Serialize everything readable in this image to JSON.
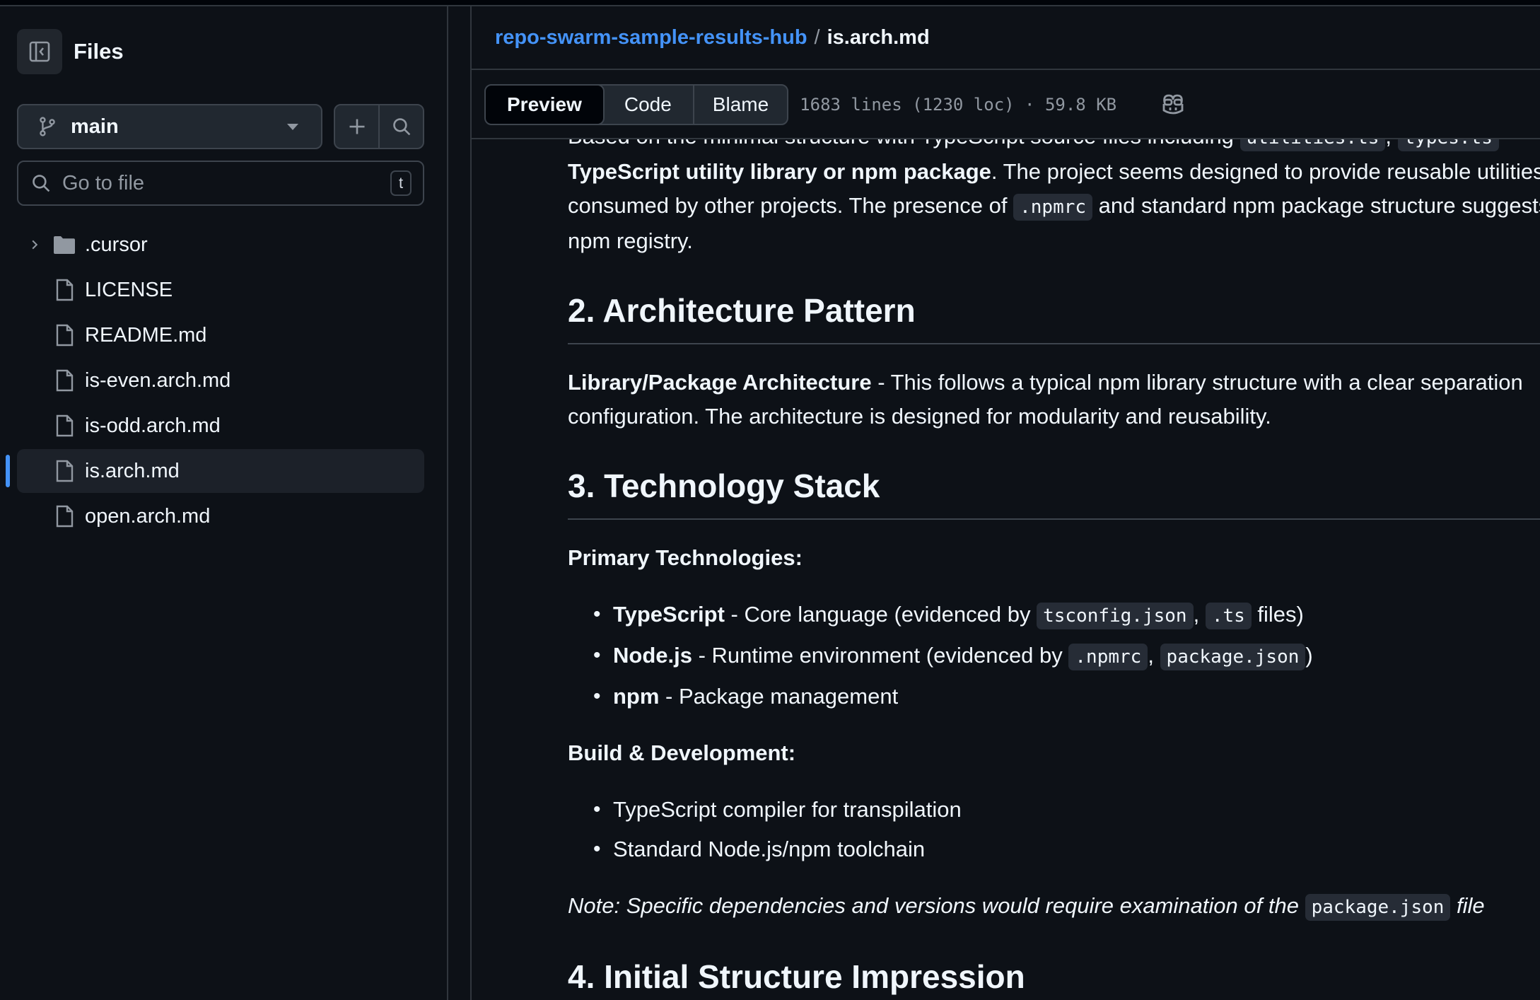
{
  "sidebar": {
    "title": "Files",
    "branch": "main",
    "goto_placeholder": "Go to file",
    "goto_shortcut": "t",
    "tree": [
      {
        "label": ".cursor",
        "type": "folder"
      },
      {
        "label": "LICENSE",
        "type": "file"
      },
      {
        "label": "README.md",
        "type": "file"
      },
      {
        "label": "is-even.arch.md",
        "type": "file"
      },
      {
        "label": "is-odd.arch.md",
        "type": "file"
      },
      {
        "label": "is.arch.md",
        "type": "file",
        "active": true
      },
      {
        "label": "open.arch.md",
        "type": "file"
      }
    ]
  },
  "breadcrumb": {
    "repo": "repo-swarm-sample-results-hub",
    "separator": "/",
    "file": "is.arch.md"
  },
  "toolbar": {
    "tabs": [
      "Preview",
      "Code",
      "Blame"
    ],
    "selected_tab": "Preview",
    "file_info": "1683 lines (1230 loc) · 59.8 KB"
  },
  "doc": {
    "intro": {
      "l1_a": "Based on the minimal structure with TypeScript source files including ",
      "l1_code1": "utilities.ts",
      "l1_b": ", ",
      "l1_code2": "types.ts",
      "l2_bold": "TypeScript utility library or npm package",
      "l2_rest": ". The project seems designed to provide reusable utilities",
      "l3_a": "consumed by other projects. The presence of ",
      "l3_code": ".npmrc",
      "l3_b": " and standard npm package structure suggests",
      "l4": "npm registry."
    },
    "s2": {
      "heading": "2. Architecture Pattern",
      "bold": "Library/Package Architecture",
      "text1": " - This follows a typical npm library structure with a clear separation",
      "text2": "configuration. The architecture is designed for modularity and reusability."
    },
    "s3": {
      "heading": "3. Technology Stack",
      "primary_label": "Primary Technologies:",
      "primary": [
        {
          "bold": "TypeScript",
          "text": " - Core language (evidenced by ",
          "code1": "tsconfig.json",
          "sep": ", ",
          "code2": ".ts",
          "end": " files)"
        },
        {
          "bold": "Node.js",
          "text": " - Runtime environment (evidenced by ",
          "code1": ".npmrc",
          "sep": ", ",
          "code2": "package.json",
          "end": ")"
        },
        {
          "bold": "npm",
          "text": " - Package management"
        }
      ],
      "build_label": "Build & Development:",
      "build": [
        "TypeScript compiler for transpilation",
        "Standard Node.js/npm toolchain"
      ],
      "note_a": "Note: Specific dependencies and versions would require examination of the ",
      "note_code": "package.json",
      "note_b": " file"
    },
    "s4": {
      "heading": "4. Initial Structure Impression"
    }
  }
}
